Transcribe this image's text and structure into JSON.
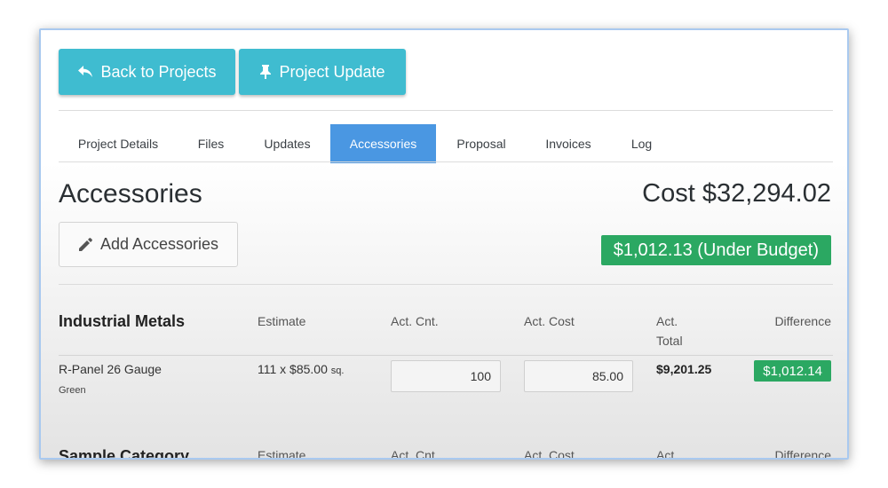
{
  "header": {
    "back_label": "Back to Projects",
    "update_label": "Project Update"
  },
  "tabs": [
    {
      "label": "Project Details",
      "active": false
    },
    {
      "label": "Files",
      "active": false
    },
    {
      "label": "Updates",
      "active": false
    },
    {
      "label": "Accessories",
      "active": true
    },
    {
      "label": "Proposal",
      "active": false
    },
    {
      "label": "Invoices",
      "active": false
    },
    {
      "label": "Log",
      "active": false
    }
  ],
  "page": {
    "title": "Accessories",
    "cost": "Cost $32,294.02",
    "add_label": "Add Accessories",
    "budget_status": "$1,012.13 (Under Budget)"
  },
  "columns": {
    "estimate": "Estimate",
    "act_cnt": "Act. Cnt.",
    "act_cost": "Act. Cost",
    "act_total_1": "Act.",
    "act_total_2": "Total",
    "difference": "Difference"
  },
  "categories": [
    {
      "name": "Industrial Metals",
      "items": [
        {
          "name": "R-Panel 26 Gauge",
          "variant": "Green",
          "estimate": "111 x $85.00",
          "estimate_unit": "sq.",
          "act_cnt": "100",
          "act_cost": "85.00",
          "act_total": "$9,201.25",
          "difference": "$1,012.14"
        }
      ]
    },
    {
      "name": "Sample Category",
      "items": []
    }
  ],
  "colors": {
    "primary": "#3fbcd0",
    "active_tab": "#4a97e2",
    "success": "#2ba862",
    "window_border": "#a9c9ef"
  },
  "icons": {
    "back": "reply-arrow-icon",
    "update": "pushpin-icon",
    "add": "pencil-icon"
  }
}
